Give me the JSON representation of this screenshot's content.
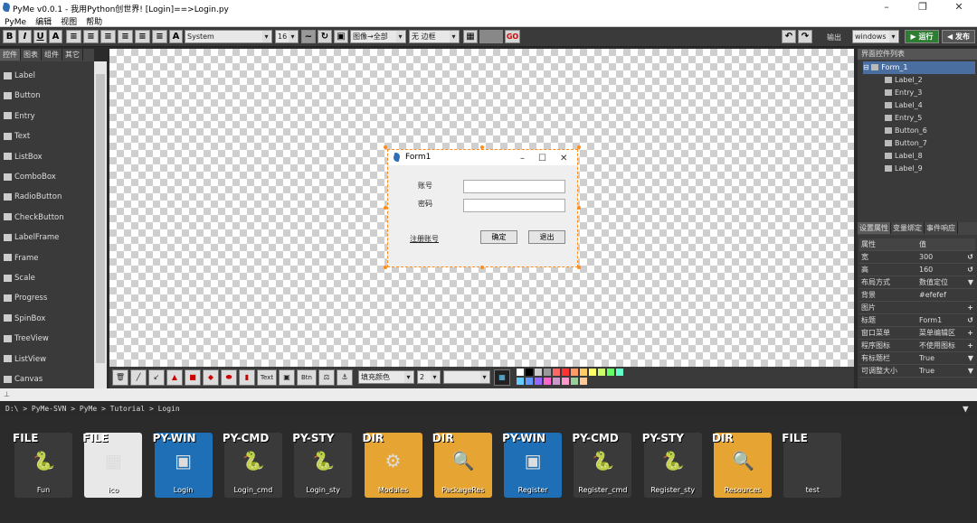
{
  "window": {
    "title": "PyMe v0.0.1 - 我用Python创世界!   [Login]==>Login.py",
    "controls": [
      "–",
      "❐",
      "✕"
    ]
  },
  "menu": [
    "PyMe",
    "编辑",
    "视图",
    "帮助"
  ],
  "toolbar": {
    "format_buttons": [
      "B",
      "I",
      "U",
      "A"
    ],
    "font_family": "System",
    "font_size": "16",
    "image_mode": "图像→全部",
    "border": "无 边框",
    "output_label": "输出",
    "platform": "windows",
    "run_label": "运行",
    "publish_label": "发布"
  },
  "left_tabs": [
    "控件",
    "图表",
    "组件",
    "其它"
  ],
  "widgets": [
    "Label",
    "Button",
    "Entry",
    "Text",
    "ListBox",
    "ComboBox",
    "RadioButton",
    "CheckButton",
    "LabelFrame",
    "Frame",
    "Scale",
    "Progress",
    "SpinBox",
    "TreeView",
    "ListView",
    "Canvas"
  ],
  "form": {
    "title": "Form1",
    "account_label": "账号",
    "password_label": "密码",
    "register_label": "注册账号",
    "ok_label": "确定",
    "exit_label": "退出"
  },
  "drawbar": {
    "text_btn": "Text",
    "btn_btn": "Btn",
    "fill_color": "填充颜色",
    "line_width": "2"
  },
  "palette": [
    "#ffffff",
    "#000000",
    "#cccccc",
    "#999999",
    "#ff6666",
    "#ff3333",
    "#ff9966",
    "#ffcc66",
    "#ffff66",
    "#ccff66",
    "#66ff66",
    "#66ffcc",
    "#66ccff",
    "#6699ff",
    "#9966ff",
    "#ff66cc",
    "#cc99cc",
    "#ff99cc",
    "#99cc99",
    "#ffcc99"
  ],
  "right": {
    "tree_title": "界面控件列表",
    "tree": [
      {
        "label": "Form_1",
        "level": 0
      },
      {
        "label": "Label_2",
        "level": 1
      },
      {
        "label": "Entry_3",
        "level": 1
      },
      {
        "label": "Label_4",
        "level": 1
      },
      {
        "label": "Entry_5",
        "level": 1
      },
      {
        "label": "Button_6",
        "level": 1
      },
      {
        "label": "Button_7",
        "level": 1
      },
      {
        "label": "Label_8",
        "level": 1
      },
      {
        "label": "Label_9",
        "level": 1
      }
    ],
    "prop_tabs": [
      "设置属性",
      "变量绑定",
      "事件响应"
    ],
    "prop_header": {
      "k": "属性",
      "v": "值"
    },
    "props": [
      {
        "k": "宽",
        "v": "300",
        "a": "↺"
      },
      {
        "k": "高",
        "v": "160",
        "a": "↺"
      },
      {
        "k": "布局方式",
        "v": "数值定位",
        "a": "▼"
      },
      {
        "k": "背景",
        "v": "#efefef",
        "a": ""
      },
      {
        "k": "图片",
        "v": "",
        "a": "+"
      },
      {
        "k": "标题",
        "v": "Form1",
        "a": "↺"
      },
      {
        "k": "窗口菜单",
        "v": "菜单编辑区",
        "a": "+"
      },
      {
        "k": "程序图标",
        "v": "不使用图标",
        "a": "+"
      },
      {
        "k": "有标题栏",
        "v": "True",
        "a": "▼"
      },
      {
        "k": "可调整大小",
        "v": "True",
        "a": "▼"
      }
    ]
  },
  "path": "D:\\ > PyMe-SVN > PyMe > Tutorial > Login",
  "files": [
    {
      "type": "FILE",
      "name": "Fun",
      "bg": "#3a3a3a",
      "glyph": "🐍"
    },
    {
      "type": "FILE",
      "name": "ico",
      "bg": "#e8e8e8",
      "glyph": "▦"
    },
    {
      "type": "PY-WIN",
      "name": "Login",
      "bg": "#1e6fb5",
      "glyph": "▣"
    },
    {
      "type": "PY-CMD",
      "name": "Login_cmd",
      "bg": "#3a3a3a",
      "glyph": "🐍"
    },
    {
      "type": "PY-STY",
      "name": "Login_sty",
      "bg": "#3a3a3a",
      "glyph": "🐍"
    },
    {
      "type": "DIR",
      "name": "Modules",
      "bg": "#e6a532",
      "glyph": "⚙"
    },
    {
      "type": "DIR",
      "name": "PackageRes",
      "bg": "#e6a532",
      "glyph": "🔍"
    },
    {
      "type": "PY-WIN",
      "name": "Register",
      "bg": "#1e6fb5",
      "glyph": "▣"
    },
    {
      "type": "PY-CMD",
      "name": "Register_cmd",
      "bg": "#3a3a3a",
      "glyph": "🐍"
    },
    {
      "type": "PY-STY",
      "name": "Register_sty",
      "bg": "#3a3a3a",
      "glyph": "🐍"
    },
    {
      "type": "DIR",
      "name": "Resources",
      "bg": "#e6a532",
      "glyph": "🔍"
    },
    {
      "type": "FILE",
      "name": "test",
      "bg": "#3a3a3a",
      "glyph": ""
    }
  ]
}
